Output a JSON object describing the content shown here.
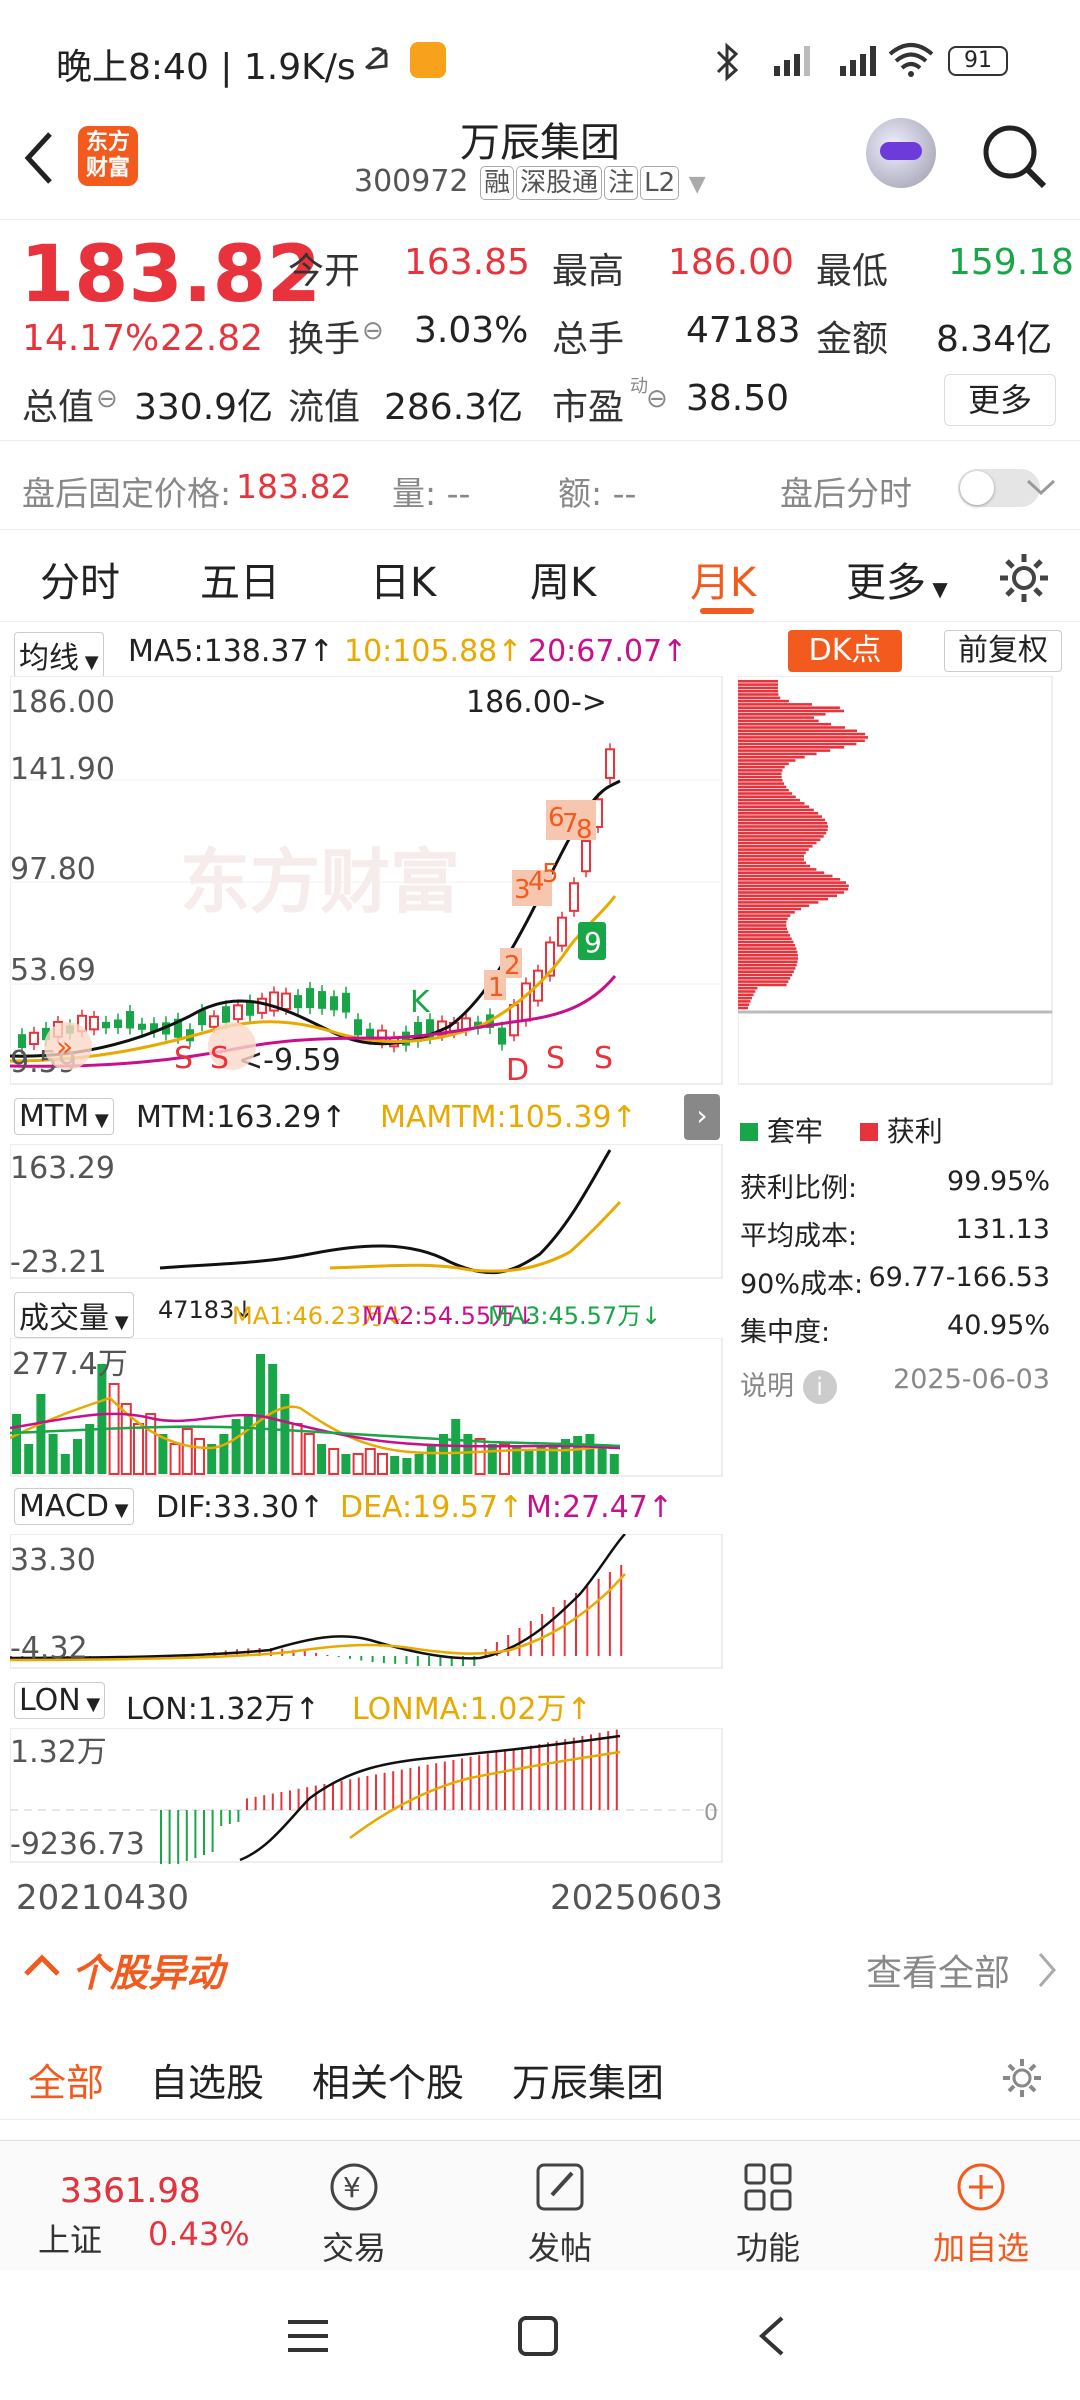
{
  "status": {
    "time": "晚上8:40 | 1.9K/s",
    "battery": "91"
  },
  "header": {
    "title": "万辰集团",
    "code": "300972",
    "tags": [
      "融",
      "深股通",
      "注",
      "L2"
    ],
    "logo_text_1": "东方",
    "logo_text_2": "财富"
  },
  "quote": {
    "price": "183.82",
    "pct": "14.17%",
    "change": "22.82",
    "open_label": "今开",
    "open": "163.85",
    "high_label": "最高",
    "high": "186.00",
    "low_label": "最低",
    "low": "159.18",
    "turnover_label": "换手",
    "turnover": "3.03%",
    "volume_label": "总手",
    "volume": "47183",
    "amount_label": "金额",
    "amount": "8.34亿",
    "mktcap_label": "总值",
    "mktcap": "330.9亿",
    "float_label": "流值",
    "float": "286.3亿",
    "pe_label": "市盈",
    "pe_sup": "动",
    "pe": "38.50",
    "more": "更多"
  },
  "after_hours": {
    "price_label": "盘后固定价格:",
    "price": "183.82",
    "vol_label": "量: --",
    "amt_label": "额: --",
    "timeshare": "盘后分时"
  },
  "tabs": [
    "分时",
    "五日",
    "日K",
    "周K",
    "月K",
    "更多"
  ],
  "tab_active": "月K",
  "kline": {
    "ma_select": "均线",
    "ma5": "MA5:138.37↑",
    "ma10": "10:105.88↑",
    "ma20": "20:67.07↑",
    "dk": "DK点",
    "fq": "前复权",
    "y_labels": [
      "186.00",
      "141.90",
      "97.80",
      "53.69",
      "9.59"
    ],
    "high_mark": "186.00->",
    "low_mark": "<-9.59",
    "signals": [
      "S",
      "S",
      "K",
      "D",
      "S",
      "S",
      "1",
      "2",
      "3",
      "4",
      "5",
      "6",
      "7",
      "8",
      "9"
    ]
  },
  "mtm": {
    "select": "MTM",
    "mtm": "MTM:163.29↑",
    "mamtm": "MAMTM:105.39↑",
    "y": [
      "163.29",
      "-23.21"
    ]
  },
  "volume": {
    "select": "成交量",
    "v": "47183↓",
    "ma1": "MA1:46.23万↓",
    "ma2": "MA2:54.55万↓",
    "ma3": "MA3:45.57万↓",
    "y": "277.4万"
  },
  "macd": {
    "select": "MACD",
    "dif": "DIF:33.30↑",
    "dea": "DEA:19.57↑",
    "m": "M:27.47↑",
    "y": [
      "33.30",
      "-4.32"
    ]
  },
  "lon": {
    "select": "LON",
    "lon": "LON:1.32万↑",
    "lonma": "LONMA:1.02万↑",
    "y": [
      "1.32万",
      "-9236.73"
    ],
    "zero": "0"
  },
  "dates": [
    "20210430",
    "20250603"
  ],
  "chips": {
    "legend_trapped": "套牢",
    "legend_profit": "获利",
    "rows": [
      {
        "label": "获利比例:",
        "value": "99.95%"
      },
      {
        "label": "平均成本:",
        "value": "131.13"
      },
      {
        "label": "90%成本:",
        "value": "69.77-166.53"
      },
      {
        "label": "集中度:",
        "value": "40.95%"
      }
    ],
    "note": "说明",
    "date": "2025-06-03"
  },
  "movers": {
    "title": "个股异动",
    "all": "查看全部"
  },
  "filter": {
    "tabs": [
      "全部",
      "自选股",
      "相关个股",
      "万辰集团"
    ],
    "active": "全部"
  },
  "bottom": {
    "index_value": "3361.98",
    "index_name": "上证",
    "index_pct": "0.43%",
    "nav": [
      "交易",
      "发帖",
      "功能",
      "加自选"
    ]
  },
  "colors": {
    "red": "#e8333c",
    "green": "#19a648",
    "gold": "#e8a900",
    "magenta": "#c8108c",
    "brand": "#f25a1e"
  }
}
